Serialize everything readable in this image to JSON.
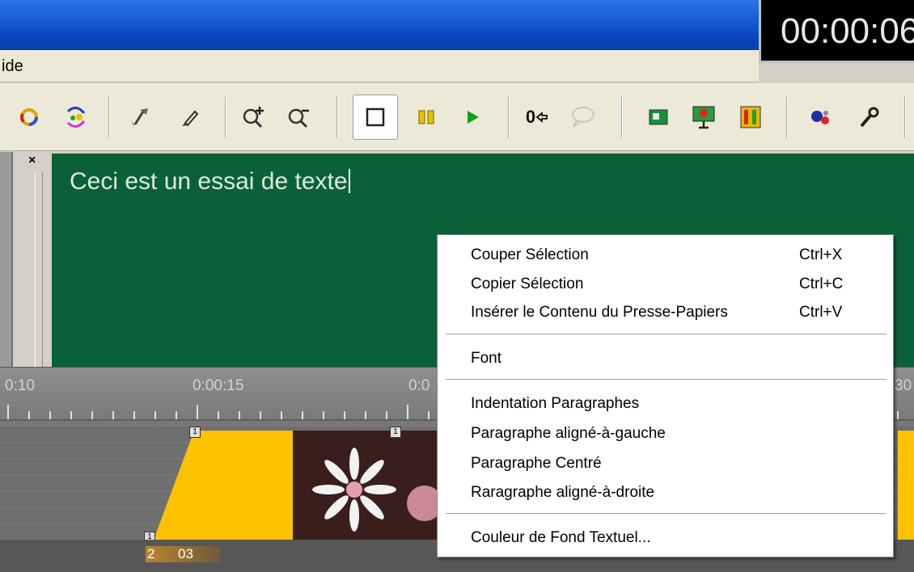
{
  "timecode": "00:00:06",
  "menu": {
    "help_partial": "ide"
  },
  "toolbar": {
    "buttons": [
      "refresh-left-icon",
      "refresh-right-icon",
      "selection-tool-icon",
      "pen-tool-icon",
      "zoom-in-icon",
      "zoom-out-icon",
      "stop-icon",
      "pause-icon",
      "play-icon",
      "counter-reset-icon",
      "speech-bubble-icon",
      "image-icon",
      "presentation-icon",
      "film-strip-icon",
      "color-dots-icon",
      "wrench-icon"
    ],
    "counter_label": "0"
  },
  "editor": {
    "text": "Ceci est un essai de texte",
    "background": "#0a6137"
  },
  "ruler": {
    "labels": [
      "0:10",
      "0:00:15",
      "0:0",
      "30"
    ]
  },
  "track": {
    "label_2": "2",
    "label_03": "03",
    "marker": "1"
  },
  "context_menu": {
    "cut": {
      "label": "Couper Sélection",
      "shortcut": "Ctrl+X"
    },
    "copy": {
      "label": "Copier Sélection",
      "shortcut": "Ctrl+C"
    },
    "paste": {
      "label": "Insérer le Contenu du Presse-Papiers",
      "shortcut": "Ctrl+V"
    },
    "font": {
      "label": "Font"
    },
    "indent": {
      "label": "Indentation Paragraphes"
    },
    "align_left": {
      "label": "Paragraphe aligné-à-gauche"
    },
    "center": {
      "label": "Paragraphe Centré"
    },
    "align_right": {
      "label": "Raragraphe aligné-à-droite"
    },
    "bg_color": {
      "label": "Couleur de Fond Textuel..."
    }
  },
  "colors": {
    "title_blue": "#0b47c0",
    "track_yellow": "#ffc200",
    "pause_yellow": "#e8c000",
    "play_green": "#12a012"
  }
}
